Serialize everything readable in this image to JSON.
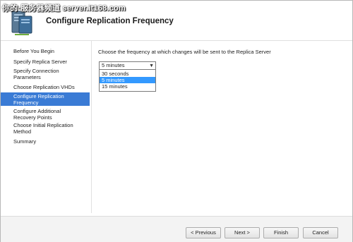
{
  "watermark": "你的·服务器频道 server.it168.com",
  "header": {
    "title": "Configure Replication Frequency",
    "icon": "server-replication-icon"
  },
  "sidebar": {
    "items": [
      {
        "label": "Before You Begin"
      },
      {
        "label": "Specify Replica Server"
      },
      {
        "label": "Specify Connection Parameters"
      },
      {
        "label": "Choose Replication VHDs"
      },
      {
        "label": "Configure Replication Frequency",
        "active": true
      },
      {
        "label": "Configure Additional Recovery Points"
      },
      {
        "label": "Choose Initial Replication Method"
      },
      {
        "label": "Summary"
      }
    ]
  },
  "main": {
    "instruction": "Choose the frequency at which changes will be sent to the Replica Server",
    "frequency_select": {
      "value": "5 minutes",
      "options": [
        "30 seconds",
        "5 minutes",
        "15 minutes"
      ],
      "highlighted": "5 minutes"
    }
  },
  "footer": {
    "previous_label": "< Previous",
    "next_label": "Next >",
    "finish_label": "Finish",
    "cancel_label": "Cancel"
  },
  "colors": {
    "nav_active": "#3a7bd5",
    "option_highlight": "#3399ff"
  }
}
